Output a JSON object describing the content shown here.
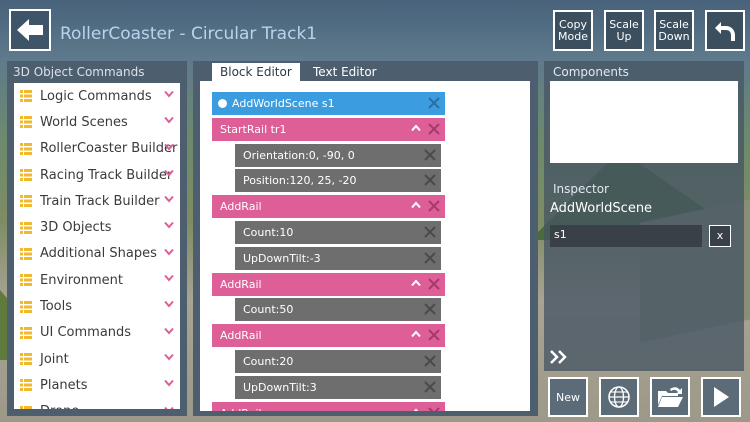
{
  "header": {
    "title": "RollerCoaster - Circular Track1",
    "buttons": {
      "copy_mode": "Copy Mode",
      "scale_up": "Scale Up",
      "scale_down": "Scale Down"
    }
  },
  "left_panel": {
    "title": "3D Object Commands",
    "items": [
      {
        "label": "Logic Commands"
      },
      {
        "label": "World Scenes"
      },
      {
        "label": "RollerCoaster Builder"
      },
      {
        "label": "Racing Track Builder"
      },
      {
        "label": "Train Track Builder"
      },
      {
        "label": "3D Objects"
      },
      {
        "label": "Additional Shapes"
      },
      {
        "label": "Environment"
      },
      {
        "label": "Tools"
      },
      {
        "label": "UI Commands"
      },
      {
        "label": "Joint"
      },
      {
        "label": "Planets"
      },
      {
        "label": "Drone"
      }
    ]
  },
  "editor": {
    "tabs": {
      "block": "Block Editor",
      "text": "Text Editor"
    },
    "blocks": [
      {
        "label": "AddWorldScene s1"
      },
      {
        "label": "StartRail tr1"
      },
      {
        "label": "Orientation:0, -90, 0"
      },
      {
        "label": "Position:120, 25, -20"
      },
      {
        "label": "AddRail"
      },
      {
        "label": "Count:10"
      },
      {
        "label": "UpDownTilt:-3"
      },
      {
        "label": "AddRail"
      },
      {
        "label": "Count:50"
      },
      {
        "label": "AddRail"
      },
      {
        "label": "Count:20"
      },
      {
        "label": "UpDownTilt:3"
      },
      {
        "label": "AddRail"
      }
    ]
  },
  "right_panel": {
    "components_title": "Components",
    "inspector_title": "Inspector",
    "inspector_name": "AddWorldScene",
    "inspector_value": "s1",
    "clear_label": "x"
  },
  "bottom": {
    "new_label": "New"
  },
  "colors": {
    "accent_blue": "#3b9de0",
    "accent_pink": "#de5e98",
    "block_gray": "#6e6e6e",
    "list_icon": "#f2b92e"
  },
  "icons": [
    "back-arrow-icon",
    "undo-icon",
    "list-icon",
    "chevron-down-icon",
    "close-icon",
    "chevron-up-icon",
    "double-chevron-right-icon",
    "globe-icon",
    "open-folder-icon",
    "play-icon"
  ]
}
